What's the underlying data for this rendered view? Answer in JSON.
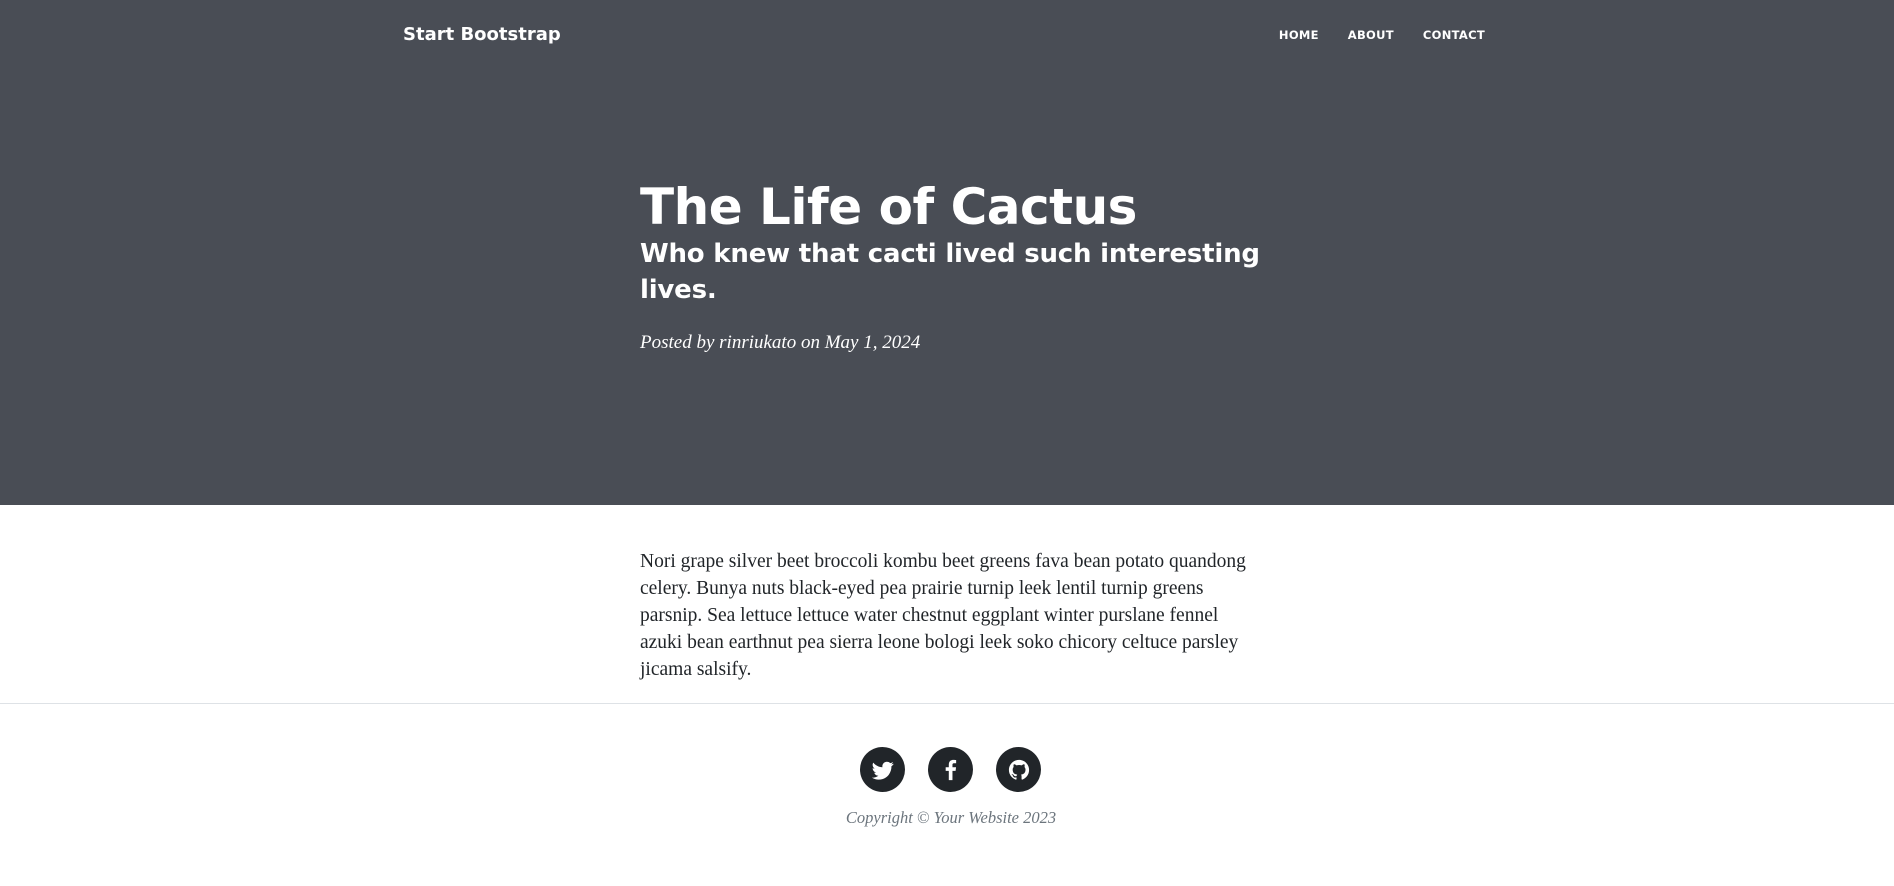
{
  "navbar": {
    "brand": "Start Bootstrap",
    "links": [
      "HOME",
      "ABOUT",
      "CONTACT"
    ]
  },
  "header": {
    "title": "The Life of Cactus",
    "subtitle": "Who knew that cacti lived such interesting lives.",
    "meta_prefix": "Posted by",
    "author": "rinriukato",
    "meta_on": "on",
    "date": "May 1, 2024",
    "background_color": "#494d55"
  },
  "post": {
    "body": "Nori grape silver beet broccoli kombu beet greens fava bean potato quandong celery. Bunya nuts black-eyed pea prairie turnip leek lentil turnip greens parsnip. Sea lettuce lettuce water chestnut eggplant winter purslane fennel azuki bean earthnut pea sierra leone bologi leek soko chicory celtuce parsley jicama salsify."
  },
  "footer": {
    "social_icons": [
      "twitter-icon",
      "facebook-icon",
      "github-icon"
    ],
    "copyright": "Copyright © Your Website 2023"
  }
}
